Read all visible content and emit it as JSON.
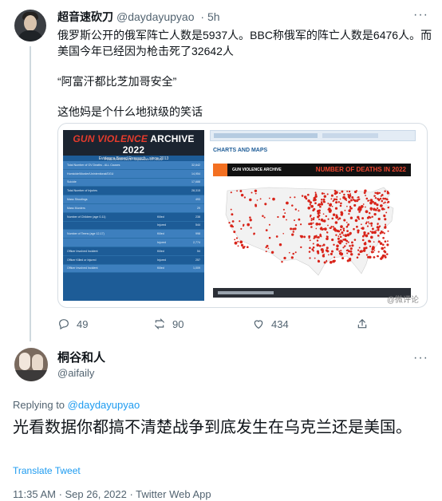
{
  "tweet1": {
    "display_name": "超音速砍刀",
    "handle": "@daydayupyao",
    "time": "· 5h",
    "more_icon": "···",
    "text": [
      "俄罗斯公开的俄军阵亡人数是5937人。BBC称俄军的阵亡人数是6476人。而美国今年已经因为枪击死了32642人",
      "“阿富汗都比芝加哥安全”",
      "这他妈是个什么地狱级的笑话"
    ],
    "media": {
      "left_title_a": "GUN VIOLENCE",
      "left_title_b": " ARCHIVE 2022",
      "left_subtitle": "Evidence Based Research - since 2013",
      "left_published": "PUBLISHED DATE: September 27, 2022",
      "rows": [
        {
          "label": "Total Number of GV Deaths - ALL Causes",
          "sub": "",
          "value": "32,642",
          "hl": true
        },
        {
          "label": "Homicide/Murder/Unintentional/DGU",
          "sub": "",
          "value": "14,954",
          "hl": true
        },
        {
          "label": "Suicide",
          "sub": "",
          "value": "17,688",
          "hl": true
        },
        {
          "label": "Total Number of Injuries",
          "sub": "",
          "value": "28,315",
          "hl": false
        },
        {
          "label": "Mass Shootings",
          "sub": "",
          "value": "493",
          "hl": true
        },
        {
          "label": "Mass Murders",
          "sub": "",
          "value": "29",
          "hl": true
        },
        {
          "label": "Number of Children (age 0-11)",
          "sub": "Killed",
          "value": "238",
          "hl": false
        },
        {
          "label": "",
          "sub": "Injured",
          "value": "544",
          "hl": false
        },
        {
          "label": "Number of Teens (age 12-17)",
          "sub": "Killed",
          "value": "998",
          "hl": true
        },
        {
          "label": "",
          "sub": "Injured",
          "value": "2,774",
          "hl": true
        },
        {
          "label": "Officer Involved Incident",
          "sub": "Killed",
          "value": "54",
          "hl": false
        },
        {
          "label": "Officer Killed or Injured",
          "sub": "Injured",
          "value": "257",
          "hl": false
        },
        {
          "label": "Officer Involved Incident",
          "sub": "Killed",
          "value": "1,009",
          "hl": true
        }
      ],
      "right_heading": "CHARTS AND MAPS",
      "map_logo_text": "GUN VIOLENCE ARCHIVE",
      "map_title": "NUMBER OF DEATHS IN 2022",
      "watermark": "@微评论"
    },
    "actions": {
      "reply_count": "49",
      "retweet_count": "90",
      "like_count": "434"
    }
  },
  "tweet2": {
    "display_name": "桐谷和人",
    "handle": "@aifaily",
    "more_icon": "···",
    "replying_prefix": "Replying to ",
    "replying_handle": "@daydayupyao",
    "text": "光看数据你都搞不清楚战争到底发生在乌克兰还是美国。",
    "translate_label": "Translate Tweet",
    "meta": "11:35 AM · Sep 26, 2022 · Twitter Web App"
  },
  "colors": {
    "accent": "#1d9bf0",
    "secondary_text": "#536471",
    "map_dot": "#d8241a"
  }
}
